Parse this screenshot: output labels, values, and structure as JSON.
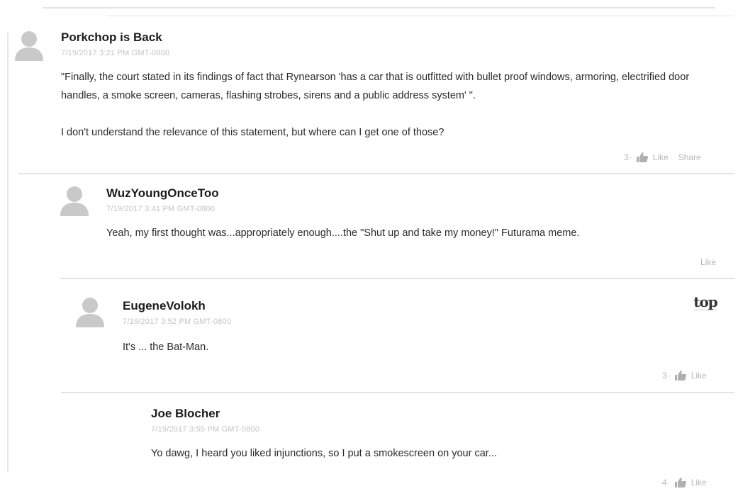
{
  "comments": [
    {
      "author": "Porkchop is Back",
      "timestamp": "7/19/2017 3:21 PM GMT-0800",
      "paragraphs": [
        "\"Finally, the court stated in its findings of fact that Rynearson 'has a car that is outfitted with bullet proof windows, armoring, electrified door handles, a smoke screen, cameras, flashing strobes, sirens and a public address system' \".",
        "I don't understand the relevance of this statement, but where can I get one of those?"
      ],
      "like_count": "3",
      "separator": "·",
      "like_label": "Like",
      "share_label": "Share"
    },
    {
      "author": "WuzYoungOnceToo",
      "timestamp": "7/19/2017 3:41 PM GMT-0800",
      "paragraphs": [
        "Yeah, my first thought was...appropriately enough....the \"Shut up and take my money!\" Futurama meme."
      ],
      "like_label": "Like"
    },
    {
      "author": "EugeneVolokh",
      "timestamp": "7/19/2017 3:52 PM GMT-0800",
      "paragraphs": [
        "It's ... the Bat-Man."
      ],
      "badge_word": "top",
      "like_count": "3",
      "separator": "·",
      "like_label": "Like"
    },
    {
      "author": "Joe Blocher",
      "timestamp": "7/19/2017 3:55 PM GMT-0800",
      "paragraphs": [
        "Yo dawg, I heard you liked injunctions, so I put a smokescreen on your car..."
      ],
      "like_count": "4",
      "separator": "·",
      "like_label": "Like"
    }
  ],
  "colors": {
    "avatar": "#c9c9c9",
    "divider": "#e3e3e3",
    "muted": "#b8b8b8"
  }
}
